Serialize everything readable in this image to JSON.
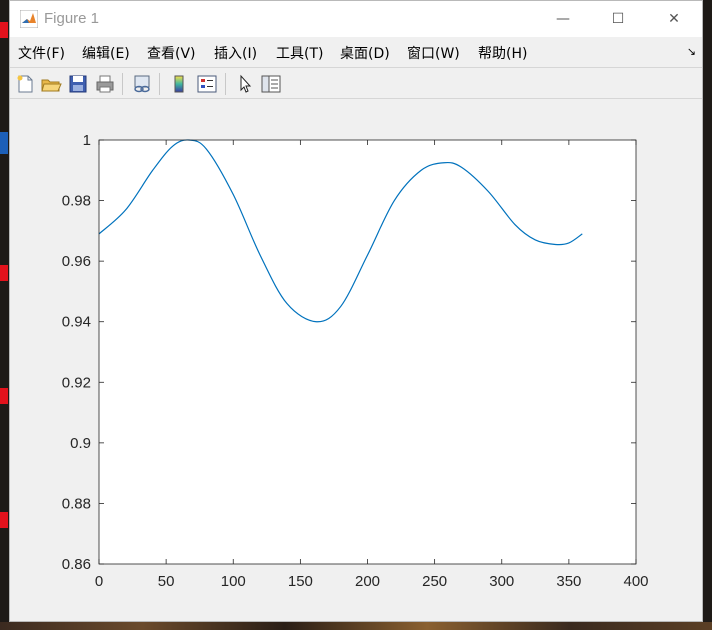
{
  "window": {
    "title": "Figure 1",
    "controls": {
      "minimize": "—",
      "maximize": "☐",
      "close": "✕"
    }
  },
  "menubar": {
    "items": [
      "文件(F)",
      "编辑(E)",
      "查看(V)",
      "插入(I)",
      "工具(T)",
      "桌面(D)",
      "窗口(W)",
      "帮助(H)"
    ],
    "overflow_glyph": "↘"
  },
  "toolbar": {
    "buttons": [
      "new-figure-icon",
      "open-file-icon",
      "save-icon",
      "print-icon",
      "link-plot-icon",
      "colorbar-icon",
      "legend-icon",
      "pointer-icon",
      "property-inspector-icon"
    ]
  },
  "chart_data": {
    "type": "line",
    "title": "",
    "xlabel": "",
    "ylabel": "",
    "xlim": [
      0,
      400
    ],
    "ylim": [
      0.86,
      1.0
    ],
    "xticks": [
      0,
      50,
      100,
      150,
      200,
      250,
      300,
      350,
      400
    ],
    "yticks": [
      0.86,
      0.88,
      0.9,
      0.92,
      0.94,
      0.96,
      0.98,
      1.0
    ],
    "ytick_labels": [
      "0.86",
      "0.88",
      "0.9",
      "0.92",
      "0.94",
      "0.96",
      "0.98",
      "1"
    ],
    "grid": false,
    "series": [
      {
        "color": "#0072bd",
        "x": [
          0,
          20,
          40,
          55,
          67,
          80,
          100,
          120,
          140,
          162,
          180,
          200,
          220,
          240,
          257,
          270,
          290,
          310,
          325,
          340,
          350,
          360
        ],
        "y": [
          0.969,
          0.977,
          0.99,
          0.998,
          1.0,
          0.997,
          0.982,
          0.962,
          0.946,
          0.94,
          0.945,
          0.962,
          0.98,
          0.99,
          0.9925,
          0.991,
          0.983,
          0.972,
          0.967,
          0.9655,
          0.966,
          0.969
        ]
      }
    ]
  }
}
